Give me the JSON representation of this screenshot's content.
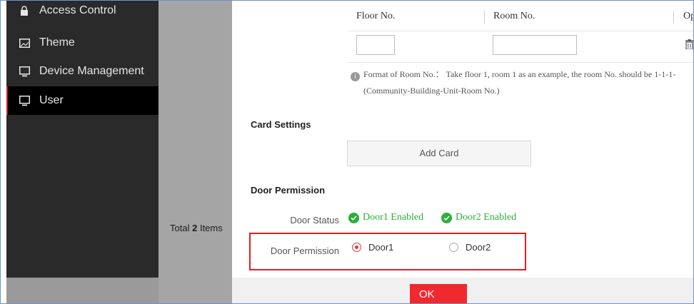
{
  "sidebar": {
    "items": [
      {
        "label": "Access Control",
        "icon": "lock-icon"
      },
      {
        "label": "Theme",
        "icon": "image-icon"
      },
      {
        "label": "Device Management",
        "icon": "monitor-icon"
      },
      {
        "label": "User",
        "icon": "monitor-icon",
        "active": true
      }
    ]
  },
  "background": {
    "total_prefix": "Total",
    "total_count": "2",
    "total_suffix": "Items"
  },
  "room_table": {
    "headers": [
      "Floor No.",
      "Room No.",
      "Op"
    ],
    "floor_value": "",
    "room_value": "",
    "note_line1": "Format of Room No.： Take floor 1, room 1 as an example, the room No. should be 1-1-1-",
    "note_line2": "(Community-Building-Unit-Room No.)"
  },
  "card_settings": {
    "title": "Card Settings",
    "add_card_label": "Add Card"
  },
  "door_permission": {
    "title": "Door Permission",
    "status_label": "Door Status",
    "status": [
      "Door1 Enabled",
      "Door2 Enabled"
    ],
    "permission_label": "Door Permission",
    "options": [
      "Door1",
      "Door2"
    ],
    "selected": "Door1"
  },
  "footer": {
    "ok_label": "OK"
  },
  "colors": {
    "accent_red": "#f0292e",
    "enabled_green": "#2aae38",
    "sidebar_bg": "#2a2a2a"
  }
}
